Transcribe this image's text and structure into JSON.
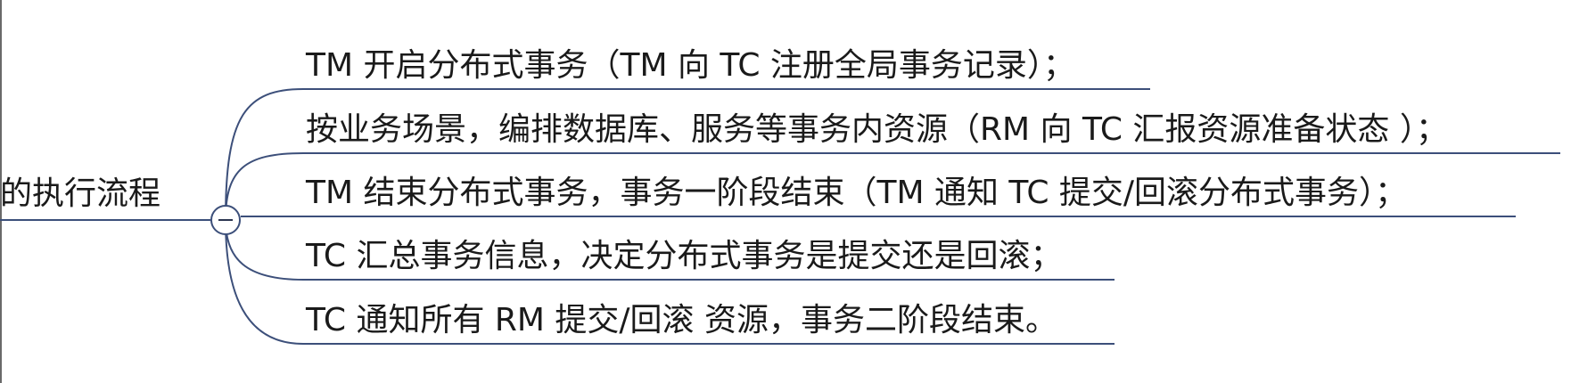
{
  "root": {
    "label": "的执行流程"
  },
  "children": [
    "TM 开启分布式事务（TM 向 TC 注册全局事务记录）；",
    "按业务场景，编排数据库、服务等事务内资源（RM 向 TC 汇报资源准备状态 ）；",
    "TM 结束分布式事务，事务一阶段结束（TM 通知 TC 提交/回滚分布式事务）；",
    "TC 汇总事务信息，决定分布式事务是提交还是回滚；",
    "TC 通知所有 RM 提交/回滚 资源，事务二阶段结束。"
  ],
  "colors": {
    "connector": "#3c4f7a",
    "text": "#1a1a1a"
  },
  "icons": {
    "toggle": "collapse-minus-icon"
  }
}
